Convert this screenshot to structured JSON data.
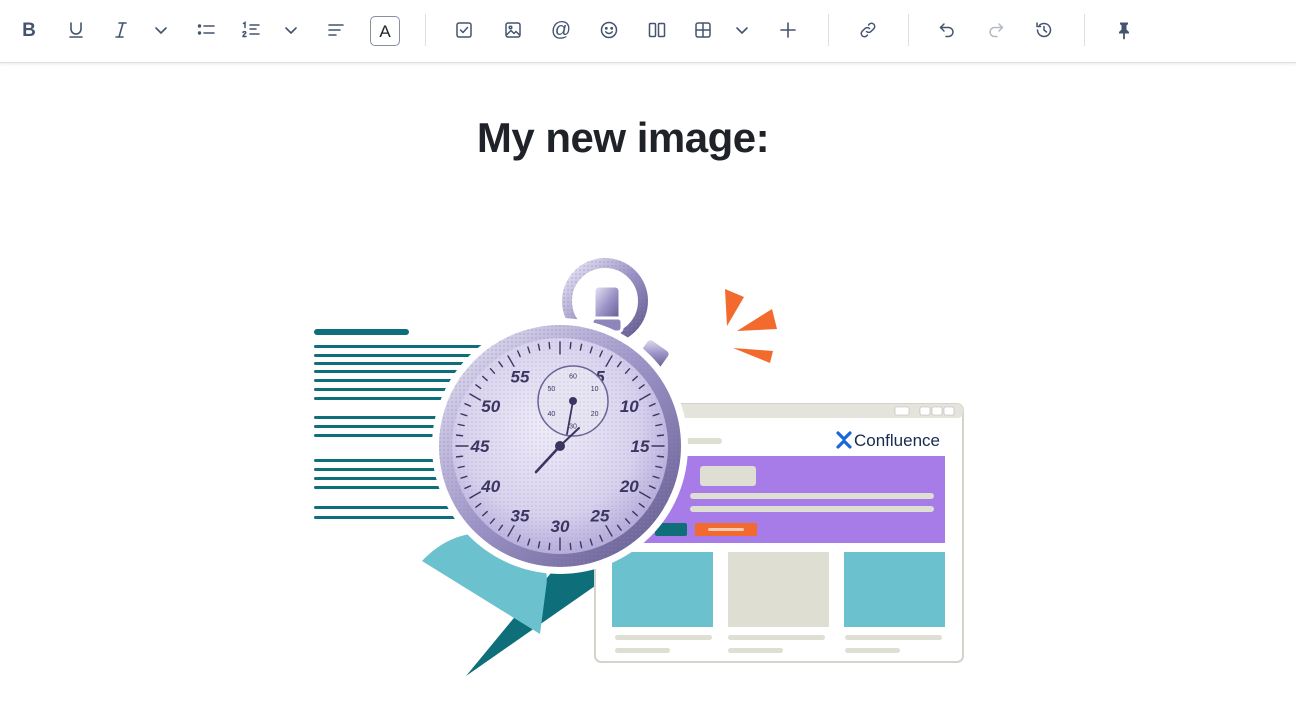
{
  "toolbar": {
    "buttons": [
      {
        "name": "bold-button",
        "icon": "bold-icon",
        "glyph": "B"
      },
      {
        "name": "underline-button",
        "icon": "underline-icon"
      },
      {
        "name": "italic-button",
        "icon": "italic-icon"
      },
      {
        "name": "more-formatting-button",
        "icon": "chevron-down-icon"
      },
      {
        "name": "bullet-list-button",
        "icon": "bullet-list-icon"
      },
      {
        "name": "numbered-list-button",
        "icon": "numbered-list-icon"
      },
      {
        "name": "list-options-button",
        "icon": "chevron-down-icon"
      },
      {
        "name": "text-alignment-button",
        "icon": "align-left-icon"
      },
      {
        "name": "text-color-button",
        "icon": "text-color-icon",
        "glyph": "A"
      },
      {
        "name": "action-item-button",
        "icon": "checkbox-icon"
      },
      {
        "name": "insert-image-button",
        "icon": "image-icon"
      },
      {
        "name": "mention-button",
        "icon": "at-icon",
        "glyph": "@"
      },
      {
        "name": "emoji-button",
        "icon": "emoji-icon"
      },
      {
        "name": "layouts-button",
        "icon": "columns-icon"
      },
      {
        "name": "insert-table-button",
        "icon": "table-icon"
      },
      {
        "name": "table-options-button",
        "icon": "chevron-down-icon"
      },
      {
        "name": "insert-more-button",
        "icon": "plus-icon"
      },
      {
        "name": "link-button",
        "icon": "link-icon"
      },
      {
        "name": "undo-button",
        "icon": "undo-icon"
      },
      {
        "name": "redo-button",
        "icon": "redo-icon",
        "disabled": true
      },
      {
        "name": "version-history-button",
        "icon": "history-icon"
      },
      {
        "name": "pin-toolbar-button",
        "icon": "pin-icon"
      }
    ]
  },
  "page": {
    "title": "My new image:"
  },
  "image": {
    "browser_brand": "Confluence",
    "stopwatch_numbers": [
      "55",
      "5",
      "10",
      "15",
      "20",
      "25",
      "30",
      "35",
      "40",
      "45",
      "50"
    ],
    "subdial_numbers": [
      "60",
      "50",
      "40",
      "30",
      "20",
      "10"
    ],
    "colors": {
      "teal": "#0E6E7A",
      "light_teal": "#6CC1CF",
      "purple": "#A77BE8",
      "orange": "#F26A2E",
      "beige": "#DFDED3",
      "stopwatch_tint": "#C9C2E6"
    }
  }
}
